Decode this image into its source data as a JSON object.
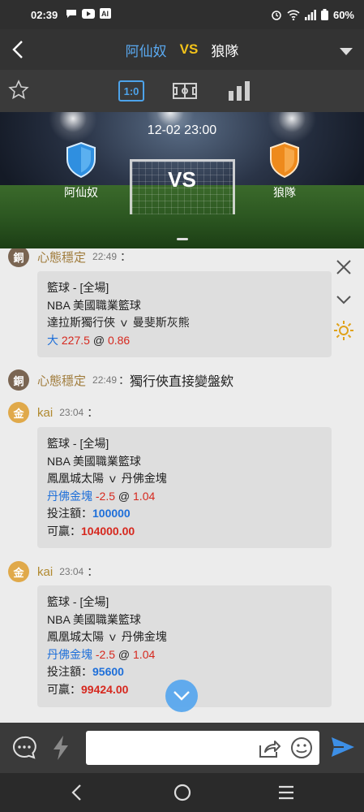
{
  "status_bar": {
    "time": "02:39",
    "battery": "60%"
  },
  "header": {
    "home_team": "阿仙奴",
    "vs": "VS",
    "away_team": "狼隊"
  },
  "toolbar": {
    "score_tab": "1:0"
  },
  "banner": {
    "datetime": "12-02 23:00",
    "home_team": "阿仙奴",
    "away_team": "狼隊",
    "vs": "VS"
  },
  "messages": [
    {
      "avatar": "銅",
      "user": "心態穩定",
      "time": "22:49",
      "colon": "：",
      "card": {
        "sport": "籃球 - [全場]",
        "league": "NBA 美國職業籃球",
        "match": "達拉斯獨行俠 ｖ 曼斐斯灰熊",
        "pick": "大",
        "line": "227.5",
        "at": "@",
        "odds": "0.86"
      }
    },
    {
      "avatar": "銅",
      "user": "心態穩定",
      "time": "22:49",
      "colon": "：",
      "text": "獨行俠直接變盤欸"
    },
    {
      "avatar": "金",
      "user": "kai",
      "time": "23:04",
      "colon": "：",
      "card": {
        "sport": "籃球 - [全場]",
        "league": "NBA 美國職業籃球",
        "match": "鳳凰城太陽 ｖ 丹佛金塊",
        "pick": "丹佛金塊",
        "line": "-2.5",
        "at": "@",
        "odds": "1.04",
        "stake_label": "投注額：",
        "stake": "100000",
        "win_label": "可贏：",
        "win": "104000.00"
      }
    },
    {
      "avatar": "金",
      "user": "kai",
      "time": "23:04",
      "colon": "：",
      "card": {
        "sport": "籃球 - [全場]",
        "league": "NBA 美國職業籃球",
        "match": "鳳凰城太陽 ｖ 丹佛金塊",
        "pick": "丹佛金塊",
        "line": "-2.5",
        "at": "@",
        "odds": "1.04",
        "stake_label": "投注額：",
        "stake": "95600",
        "win_label": "可贏：",
        "win": "99424.00"
      }
    }
  ],
  "composer": {
    "value": "",
    "placeholder": ""
  },
  "colors": {
    "accent_blue": "#4da3ea",
    "vs_yellow": "#f2c21a",
    "odds_red": "#d6281e",
    "pick_blue": "#1e6fd9"
  }
}
